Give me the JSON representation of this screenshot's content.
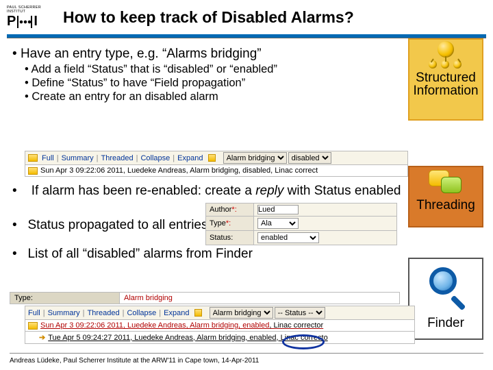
{
  "logo": {
    "small_text": "PAUL SCHERRER INSTITUT",
    "text": "PSI"
  },
  "title": "How to keep track of Disabled Alarms?",
  "bullets": {
    "b1": "Have an entry type, e.g. “Alarms bridging”",
    "s1": "Add a field “Status” that is “disabled” or “enabled”",
    "s2": "Define “Status” to have “Field propagation”",
    "s3": "Create an entry for an disabled alarm",
    "b2a": "If alarm has been re-enabled: create a ",
    "b2b": "reply",
    "b2c": " with Status enabled",
    "b3": "Status propagated to all entries in thread",
    "b4": "List of all “disabled” alarms from Finder"
  },
  "callouts": {
    "c1": "Structured Information",
    "c2": "Threading",
    "c3": "Finder"
  },
  "strip1": {
    "links": [
      "Full",
      "Summary",
      "Threaded",
      "Collapse",
      "Expand"
    ],
    "sel1_value": "Alarm bridging",
    "sel2_value": "disabled",
    "icon_name": "flag-icon",
    "entry": "Sun Apr 3 09:22:06 2011, Luedeke Andreas, Alarm bridging, disabled, Linac correct"
  },
  "form": {
    "rows": [
      {
        "k": "Author",
        "req": "*:",
        "v": "Lued"
      },
      {
        "k": "Type",
        "req": "*:",
        "v": "Ala"
      },
      {
        "k": "Status",
        "req": ":",
        "v": "enabled"
      }
    ]
  },
  "type_row": {
    "label": "Type:",
    "value": "Alarm bridging"
  },
  "strip3": {
    "links": [
      "Full",
      "Summary",
      "Threaded",
      "Collapse",
      "Expand"
    ],
    "sel1_value": "Alarm bridging",
    "sel2_value": "-- Status --",
    "entries": [
      {
        "text": "Sun Apr 3 09:22:06 2011, Luedeke Andreas, Alarm bridging,",
        "status": "enabled",
        "tail": ", Linac corrector",
        "red": true
      },
      {
        "text": "Tue Apr 5 09:24:27 2011, Luedeke Andreas, Alarm bridging, enabled, Linac correcto",
        "status": "",
        "tail": "",
        "red": false
      }
    ]
  },
  "footer": "Andreas Lüdeke, Paul Scherrer Institute at the ARW'11 in Cape town, 14-Apr-2011"
}
